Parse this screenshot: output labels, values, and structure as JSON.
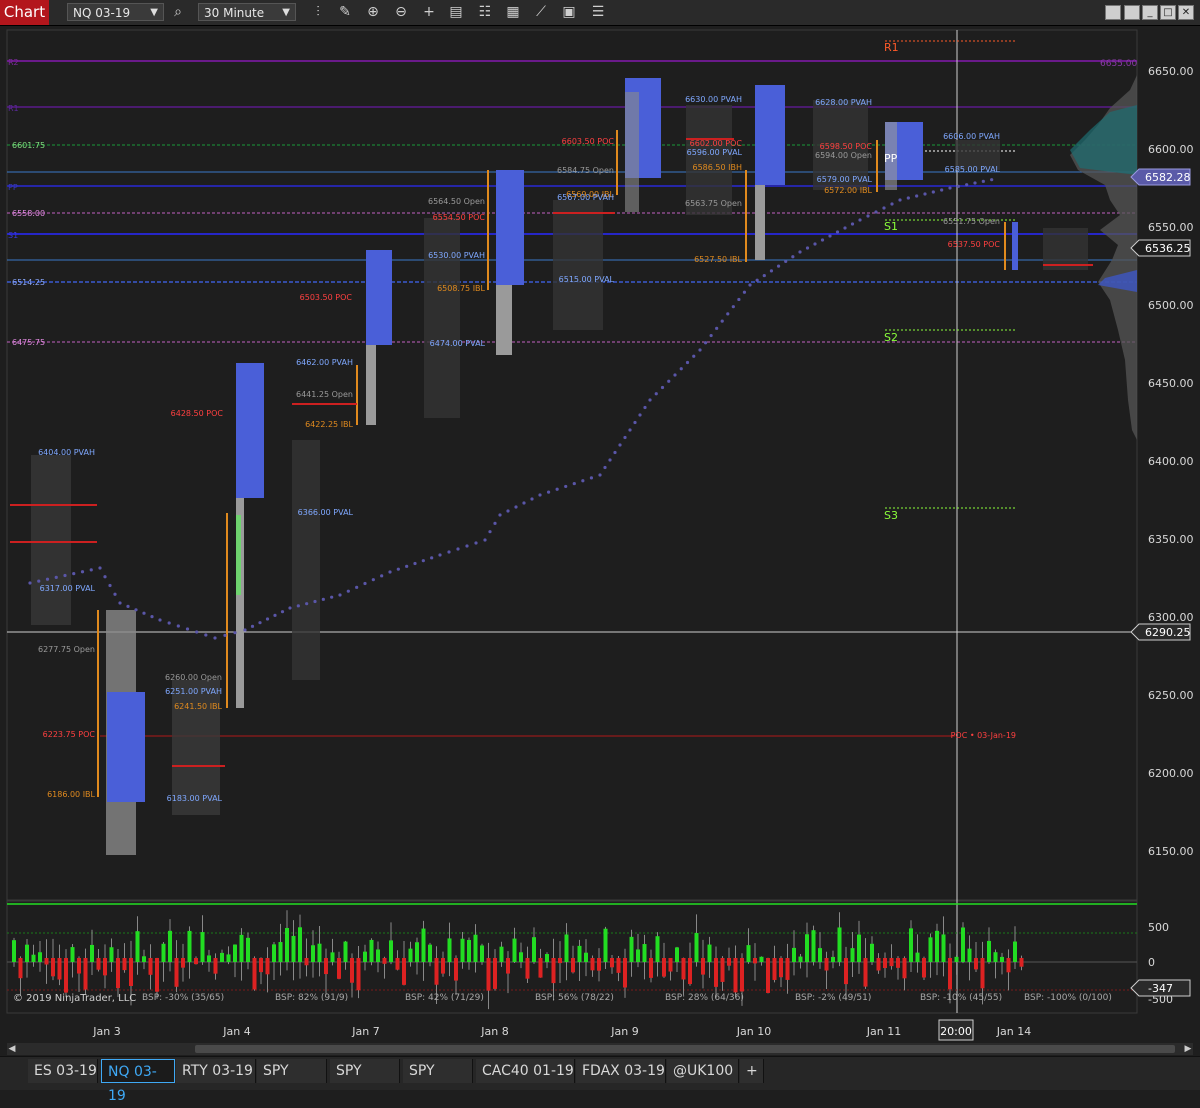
{
  "toolbar": {
    "chart_label": "Chart",
    "instrument": "NQ 03-19",
    "interval": "30 Minute",
    "icons": [
      "search-icon",
      "bar-type-icon",
      "draw-pencil-icon",
      "zoom-in-icon",
      "zoom-out-icon",
      "crosshair-icon",
      "data-box-icon",
      "properties-icon",
      "strategy-icon",
      "chart-trader-icon",
      "menu-icon"
    ],
    "window_buttons": [
      "restore-icon",
      "tile-icon",
      "minimize-icon",
      "maximize-icon",
      "close-icon"
    ]
  },
  "price_axis": {
    "ticks": [
      "6650.00",
      "6600.00",
      "6550.00",
      "6500.00",
      "6450.00",
      "6400.00",
      "6350.00",
      "6300.00",
      "6250.00",
      "6200.00",
      "6150.00"
    ],
    "last_price": "6582.28",
    "current_price": "6536.25",
    "crosshair_price": "6290.25"
  },
  "indicator_axis": {
    "ticks": [
      "500",
      "0",
      "-500"
    ],
    "current": "-347"
  },
  "time_axis": {
    "labels": [
      "Jan 3",
      "Jan 4",
      "Jan 7",
      "Jan 8",
      "Jan 9",
      "Jan 10",
      "Jan 11",
      "Jan 14"
    ],
    "crosshair_time": "20:00"
  },
  "copyright": "© 2019 NinjaTrader, LLC",
  "bsp_labels": [
    "BSP: -30% (35/65)",
    "BSP: 82% (91/9)",
    "BSP: 42% (71/29)",
    "BSP: 56% (78/22)",
    "BSP: 28% (64/36)",
    "BSP: -2% (49/51)",
    "BSP: -10% (45/55)",
    "BSP: -100% (0/100)"
  ],
  "pivots": [
    "R1",
    "PP",
    "S1",
    "S2",
    "S3"
  ],
  "left_level_labels": [
    "6601.75",
    "6558.00",
    "6514.25",
    "6475.75"
  ],
  "faint_labels": [
    "R2",
    "R1",
    "PP",
    "S1",
    "6655.00"
  ],
  "profile_labels": [
    "6404.00 PVAH",
    "6317.00 PVAL",
    "6277.75 Open",
    "6223.75 POC",
    "6186.00 IBL",
    "6260.00 Open",
    "6251.00 PVAH",
    "6241.50 IBL",
    "6183.00 PVAL",
    "6428.50 POC",
    "6462.00 PVAH",
    "6441.25 Open",
    "6422.25 IBL",
    "6366.00 PVAL",
    "6503.50 POC",
    "6564.50 Open",
    "6554.50 POC",
    "6530.00 PVAH",
    "6508.75 IBL",
    "6474.00 PVAL",
    "6603.50 POC",
    "6584.75 Open",
    "6569.00 IBL",
    "6567.00 PVAH",
    "6515.00 PVAL",
    "6630.00 PVAH",
    "6602.00 POC",
    "6596.00 PVAL",
    "6586.50 IBH",
    "6563.75 Open",
    "6527.50 IBL",
    "6628.00 PVAH",
    "6598.50 POC",
    "6594.00 Open",
    "6579.00 PVAL",
    "6572.00 IBL",
    "6606.00 PVAH",
    "6585.00 PVAL",
    "6551.75 Open",
    "6537.50 POC",
    "POC • 03-Jan-19"
  ],
  "instrument_tabs": [
    "ES 03-19",
    "NQ 03-19",
    "RTY 03-19",
    "SPY",
    "SPY",
    "SPY",
    "CAC40 01-19",
    "FDAX 03-19",
    "@UK100"
  ],
  "add_tab_label": "+",
  "colors": {
    "accent": "#3fa9f5",
    "brand": "#b3161c",
    "vwap": "#5a56a8",
    "va_blue": "#4050d0",
    "poc": "#cc2020",
    "ibl": "#e08a1e",
    "pvah": "#7fa8ff",
    "pivot_green": "#8aff3a",
    "pivot_red": "#ff5a28",
    "up": "#22dd22",
    "down": "#dd2222"
  }
}
